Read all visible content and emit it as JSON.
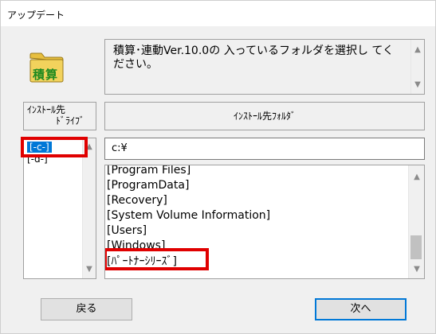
{
  "window": {
    "title": "アップデート"
  },
  "icon": {
    "name": "folder-icon",
    "label": "積算"
  },
  "message": {
    "text": "積算･連動Ver.10.0の 入っているフォルダを選択し てください。"
  },
  "drive_panel": {
    "header_line1": "ｲﾝｽﾄｰﾙ先",
    "header_line2": "ﾄﾞﾗｲﾌﾞ",
    "items": [
      {
        "label": "[-c-]",
        "selected": true
      },
      {
        "label": "[-d-]",
        "selected": false
      }
    ]
  },
  "folder_panel": {
    "header": "ｲﾝｽﾄｰﾙ先ﾌｫﾙﾀﾞ",
    "path": "c:¥",
    "folders": [
      "[Program Files]",
      "[ProgramData]",
      "[Recovery]",
      "[System Volume Information]",
      "[Users]",
      "[Windows]",
      "[ﾊﾟｰﾄﾅｰｼﾘｰｽﾞ]"
    ]
  },
  "buttons": {
    "back": "戻る",
    "next": "次へ"
  },
  "colors": {
    "selection": "#0078d7",
    "highlight": "#e00000",
    "icon_folder": "#f2d25c",
    "icon_text": "#1f8a1f"
  }
}
